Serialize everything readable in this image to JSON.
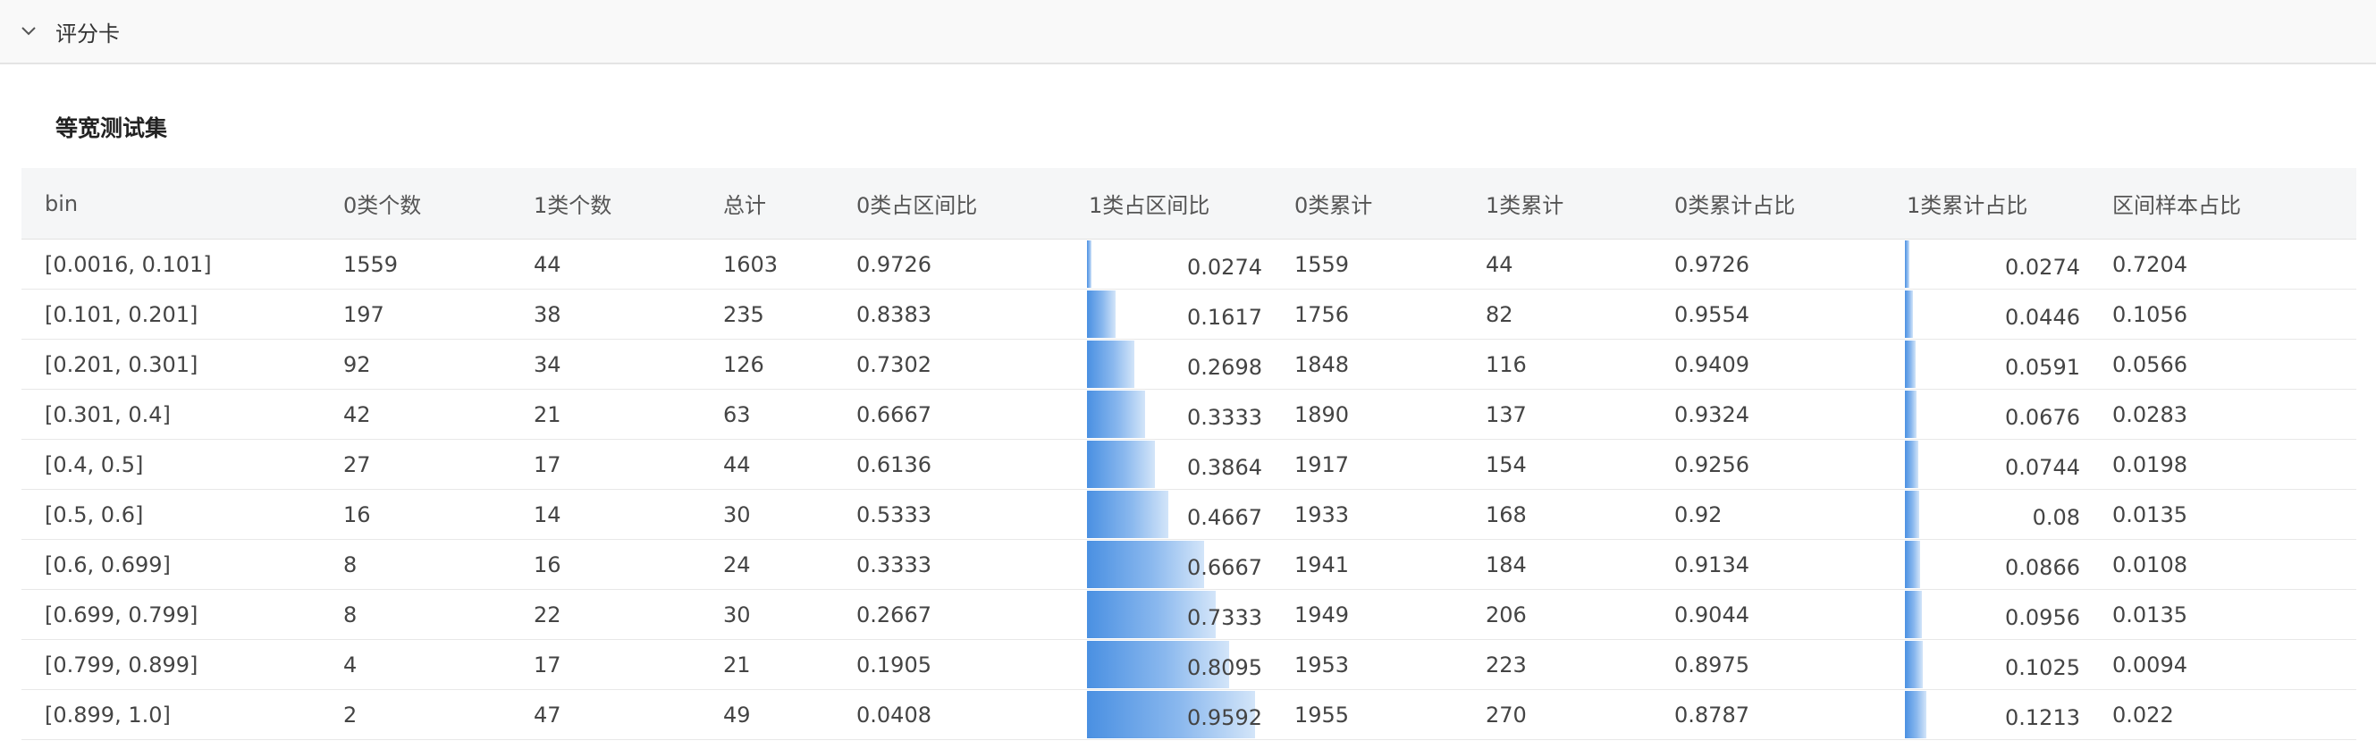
{
  "panel": {
    "title": "评分卡",
    "toggle_icon": "chevron-down-icon"
  },
  "section": {
    "title": "等宽测试集"
  },
  "table": {
    "columns": [
      "bin",
      "0类个数",
      "1类个数",
      "总计",
      "0类占区间比",
      "1类占区间比",
      "0类累计",
      "1类累计",
      "0类累计占比",
      "1类累计占比",
      "区间样本占比"
    ],
    "bar_color": "#4a90e2",
    "rows": [
      [
        "[0.0016, 0.101]",
        "1559",
        "44",
        "1603",
        "0.9726",
        "0.0274",
        "1559",
        "44",
        "0.9726",
        "0.0274",
        "0.7204"
      ],
      [
        "[0.101, 0.201]",
        "197",
        "38",
        "235",
        "0.8383",
        "0.1617",
        "1756",
        "82",
        "0.9554",
        "0.0446",
        "0.1056"
      ],
      [
        "[0.201, 0.301]",
        "92",
        "34",
        "126",
        "0.7302",
        "0.2698",
        "1848",
        "116",
        "0.9409",
        "0.0591",
        "0.0566"
      ],
      [
        "[0.301, 0.4]",
        "42",
        "21",
        "63",
        "0.6667",
        "0.3333",
        "1890",
        "137",
        "0.9324",
        "0.0676",
        "0.0283"
      ],
      [
        "[0.4, 0.5]",
        "27",
        "17",
        "44",
        "0.6136",
        "0.3864",
        "1917",
        "154",
        "0.9256",
        "0.0744",
        "0.0198"
      ],
      [
        "[0.5, 0.6]",
        "16",
        "14",
        "30",
        "0.5333",
        "0.4667",
        "1933",
        "168",
        "0.92",
        "0.08",
        "0.0135"
      ],
      [
        "[0.6, 0.699]",
        "8",
        "16",
        "24",
        "0.3333",
        "0.6667",
        "1941",
        "184",
        "0.9134",
        "0.0866",
        "0.0108"
      ],
      [
        "[0.699, 0.799]",
        "8",
        "22",
        "30",
        "0.2667",
        "0.7333",
        "1949",
        "206",
        "0.9044",
        "0.0956",
        "0.0135"
      ],
      [
        "[0.799, 0.899]",
        "4",
        "17",
        "21",
        "0.1905",
        "0.8095",
        "1953",
        "223",
        "0.8975",
        "0.1025",
        "0.0094"
      ],
      [
        "[0.899, 1.0]",
        "2",
        "47",
        "49",
        "0.0408",
        "0.9592",
        "1955",
        "270",
        "0.8787",
        "0.1213",
        "0.022"
      ]
    ]
  }
}
